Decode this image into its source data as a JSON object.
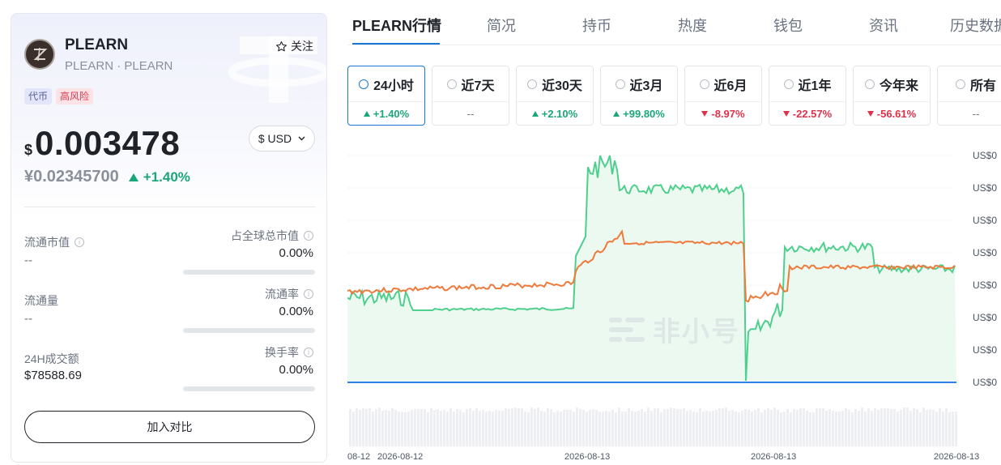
{
  "coin": {
    "name": "PLEARN",
    "subtitle": "PLEARN · PLEARN",
    "follow_label": "关注",
    "tags": [
      "代币",
      "高风险"
    ],
    "price_symbol": "$",
    "price": "0.003478",
    "currency_label": "$ USD",
    "price_cny": "¥0.02345700",
    "change_24h": "+1.40%"
  },
  "stats": {
    "market_cap_label": "流通市值",
    "market_cap_value": "--",
    "global_share_label": "占全球总市值",
    "global_share_value": "0.00%",
    "supply_label": "流通量",
    "supply_value": "--",
    "circulation_rate_label": "流通率",
    "circulation_rate_value": "0.00%",
    "volume_label": "24H成交额",
    "volume_value": "$78588.69",
    "turnover_label": "换手率",
    "turnover_value": "0.00%",
    "global_share_pct": 0,
    "circulation_rate_pct": 0,
    "turnover_pct": 0
  },
  "compare_label": "加入对比",
  "tabs": [
    "PLEARN行情",
    "简况",
    "持币",
    "热度",
    "钱包",
    "资讯",
    "历史数据"
  ],
  "periods": [
    {
      "label": "24小时",
      "change": "+1.40%",
      "dir": "up"
    },
    {
      "label": "近7天",
      "change": "--",
      "dir": "flat"
    },
    {
      "label": "近30天",
      "change": "+2.10%",
      "dir": "up"
    },
    {
      "label": "近3月",
      "change": "+99.80%",
      "dir": "up"
    },
    {
      "label": "近6月",
      "change": "-8.97%",
      "dir": "down"
    },
    {
      "label": "近1年",
      "change": "-22.57%",
      "dir": "down"
    },
    {
      "label": "今年来",
      "change": "-56.61%",
      "dir": "down"
    },
    {
      "label": "所有",
      "change": "--",
      "dir": "flat"
    }
  ],
  "chart": {
    "y_labels": [
      "US$0",
      "US$0",
      "US$0",
      "US$0",
      "US$0",
      "US$0",
      "US$0",
      "US$0"
    ],
    "x_labels": [
      "08-12",
      "2026-08-12",
      "2026-08-13",
      "2026-08-13",
      "2026-08-13"
    ],
    "watermark": "非小号",
    "colors": {
      "green": "#4fcf8d",
      "orange": "#ee7a3b",
      "blue": "#2f80ed",
      "fill": "#eaf8f0"
    }
  }
}
